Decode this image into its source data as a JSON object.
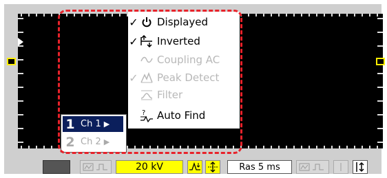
{
  "menu": {
    "items": [
      {
        "label": "Displayed",
        "checked": true,
        "enabled": true,
        "icon": "power-icon"
      },
      {
        "label": "Inverted",
        "checked": true,
        "enabled": true,
        "icon": "invert-arrows-icon"
      },
      {
        "label": "Coupling AC",
        "checked": false,
        "enabled": false,
        "icon": "sine-wave-icon"
      },
      {
        "label": "Peak Detect",
        "checked": true,
        "enabled": false,
        "icon": "peak-icon"
      },
      {
        "label": "Filter",
        "checked": false,
        "enabled": false,
        "icon": "filter-icon"
      },
      {
        "label": "Auto Find",
        "checked": false,
        "enabled": true,
        "icon": "auto-find-icon"
      }
    ],
    "check_glyph": "✓"
  },
  "channels": [
    {
      "number": "1",
      "label": "Ch 1",
      "arrow": "▶",
      "selected": true
    },
    {
      "number": "2",
      "label": "Ch 2",
      "arrow": "▶",
      "selected": false
    }
  ],
  "bottom_bar": {
    "volts_per_div": "20 kV",
    "timebase": "Ras 5 ms"
  },
  "colors": {
    "highlight": "#e8222a",
    "channel_select_bg": "#0b1f5c",
    "value_field_bg": "#ffff00"
  }
}
